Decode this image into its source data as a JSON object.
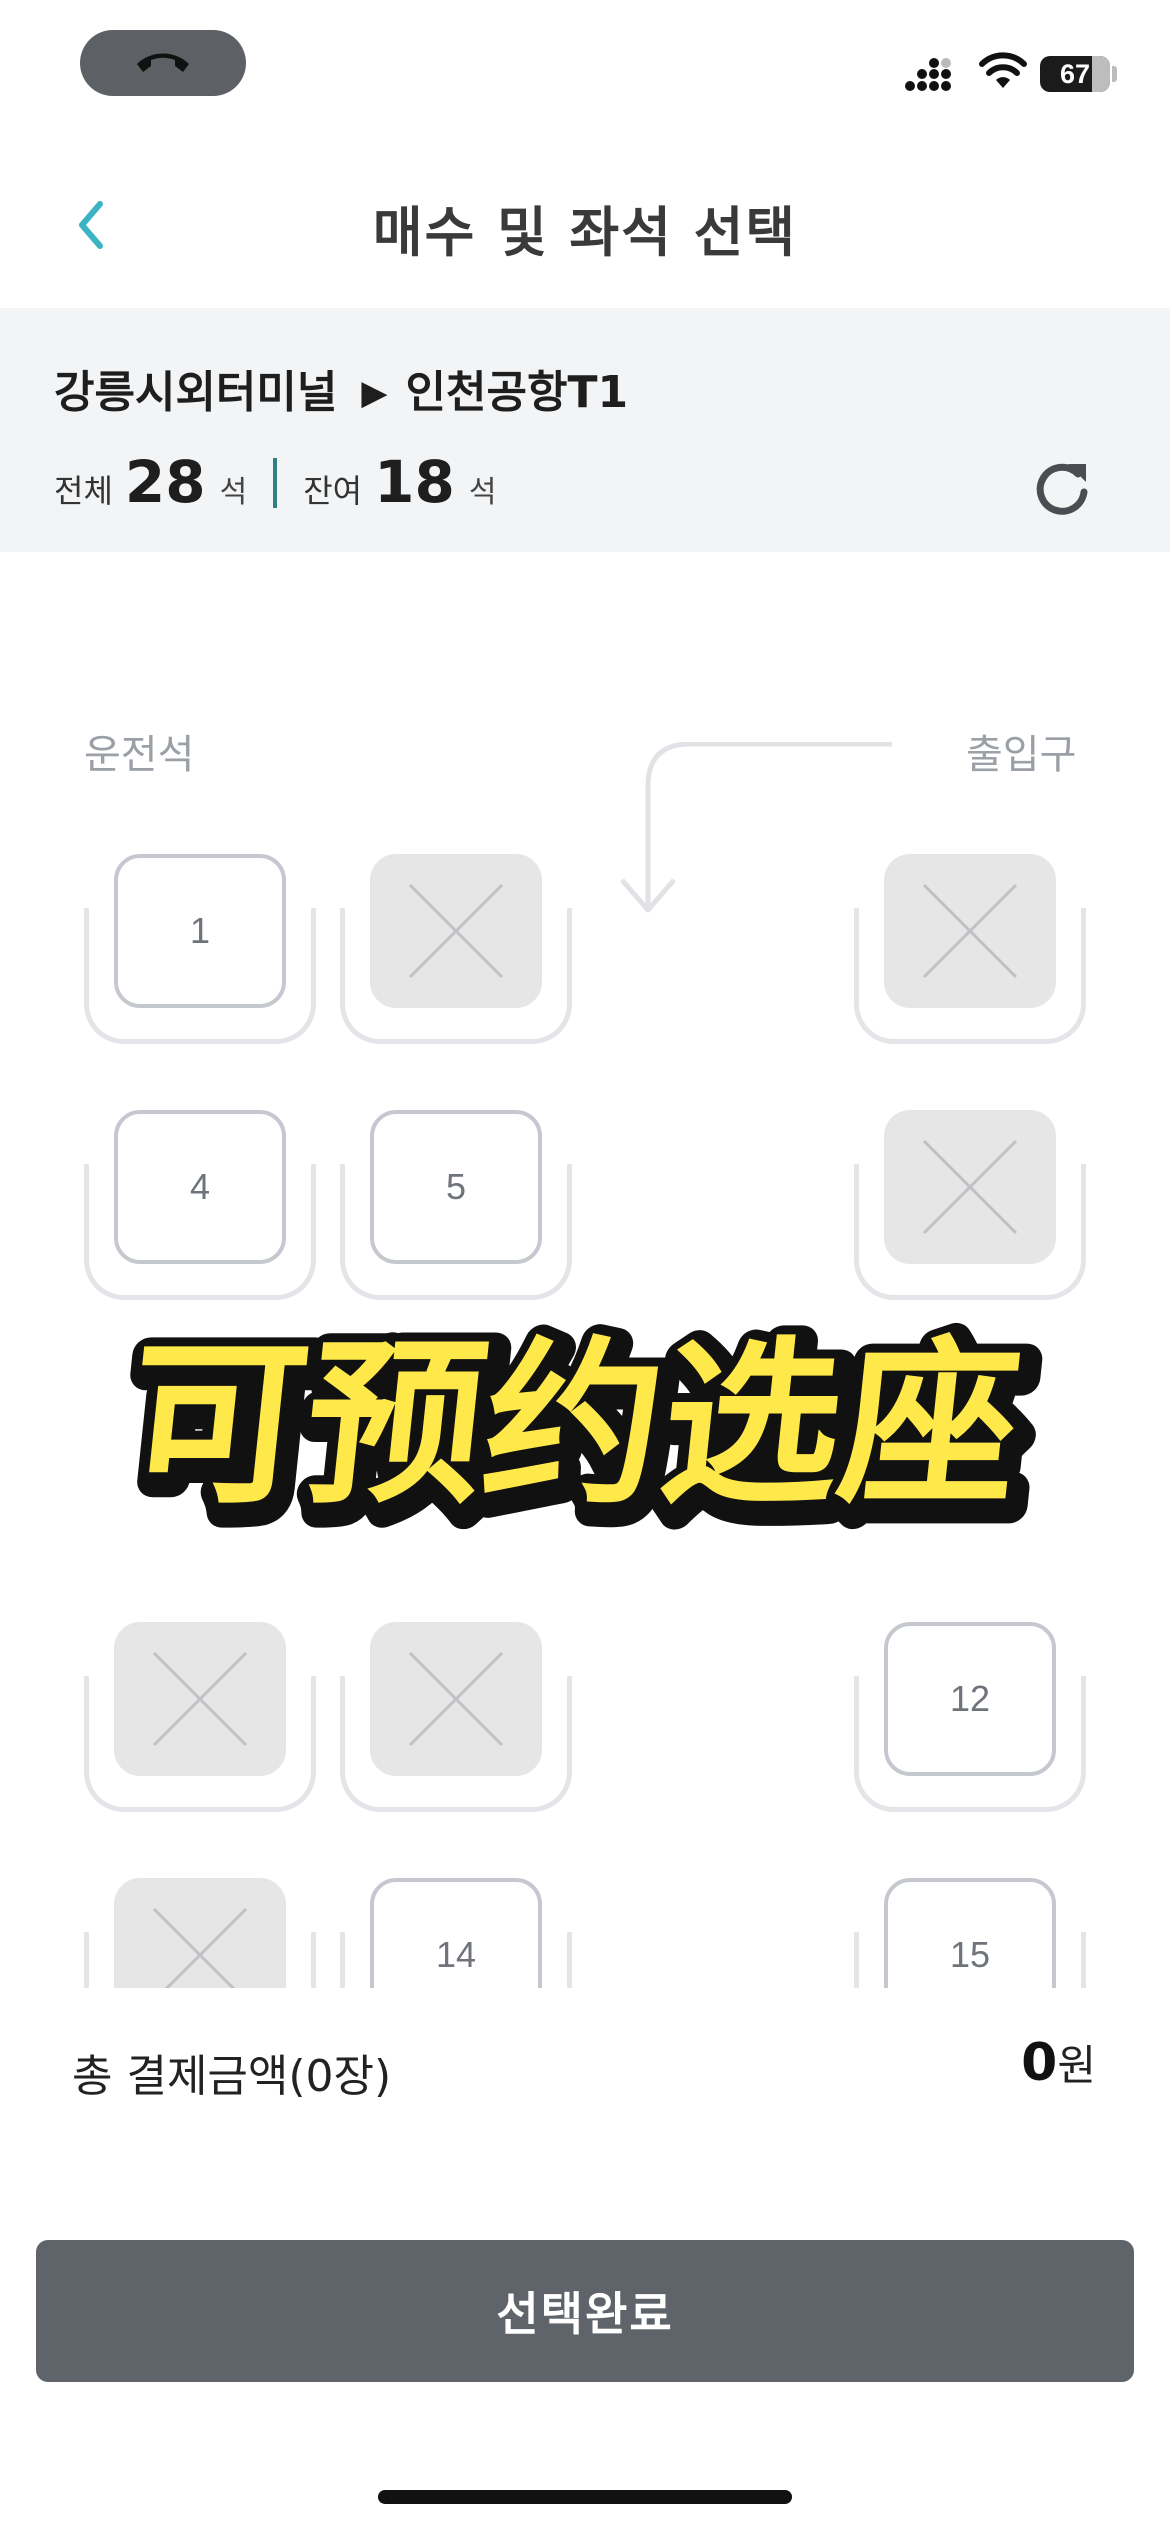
{
  "status_bar": {
    "battery": "67",
    "icons": [
      "phone-call-icon",
      "signal-icon",
      "wifi-icon",
      "battery-icon"
    ]
  },
  "header": {
    "title": "매수 및 좌석 선택",
    "back_icon": "chevron-left-icon"
  },
  "route": {
    "origin": "강릉시외터미널",
    "arrow": "▶",
    "destination": "인천공항T1",
    "total_label": "전체",
    "total_count": "28",
    "remaining_label": "잔여",
    "remaining_count": "18",
    "seat_unit": "석",
    "refresh_icon": "refresh-icon"
  },
  "seat_map": {
    "driver_label": "운전석",
    "entrance_label": "출입구",
    "seats": [
      {
        "number": "1",
        "status": "available"
      },
      {
        "number": "",
        "status": "taken"
      },
      {
        "number": "",
        "status": "taken"
      },
      {
        "number": "4",
        "status": "available"
      },
      {
        "number": "5",
        "status": "available"
      },
      {
        "number": "",
        "status": "taken"
      },
      {
        "number": "",
        "status": "taken"
      },
      {
        "number": "",
        "status": "taken"
      },
      {
        "number": "12",
        "status": "available"
      },
      {
        "number": "",
        "status": "taken"
      },
      {
        "number": "14",
        "status": "available"
      },
      {
        "number": "15",
        "status": "available"
      }
    ]
  },
  "overlay_caption": "可预约选座",
  "summary": {
    "total_label": "총 결제금액(0장)",
    "total_amount": "0",
    "currency": "원"
  },
  "confirm_button": "선택완료",
  "colors": {
    "accent": "#3bb3c3",
    "panel_bg": "#f3f4f6",
    "button_bg": "#5f646b",
    "caption_fill": "#ffe94a",
    "caption_outline": "#111111"
  }
}
